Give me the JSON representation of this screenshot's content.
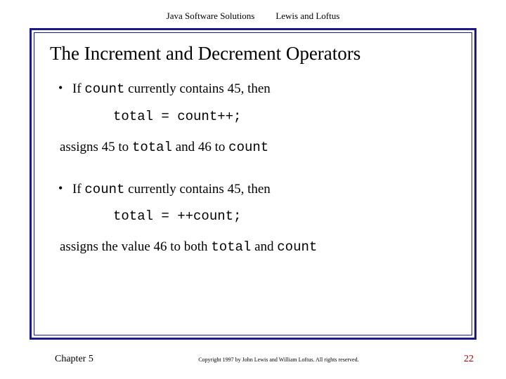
{
  "header": {
    "book": "Java Software Solutions",
    "authors": "Lewis and Loftus"
  },
  "title": "The Increment and Decrement Operators",
  "ex1": {
    "pre": "If ",
    "var": "count",
    "post": " currently contains 45, then",
    "expr": "total = count++;",
    "r1": "assigns 45 to ",
    "r1var": "total",
    "r2": " and 46 to ",
    "r2var": "count"
  },
  "ex2": {
    "pre": "If ",
    "var": "count",
    "post": " currently contains 45, then",
    "expr": "total = ++count;",
    "r1": "assigns the value 46 to both ",
    "r1var": "total",
    "r2": " and ",
    "r2var": "count"
  },
  "footer": {
    "chapter": "Chapter 5",
    "copyright": "Copyright 1997 by John Lewis and William Loftus. All rights reserved.",
    "page": "22"
  }
}
